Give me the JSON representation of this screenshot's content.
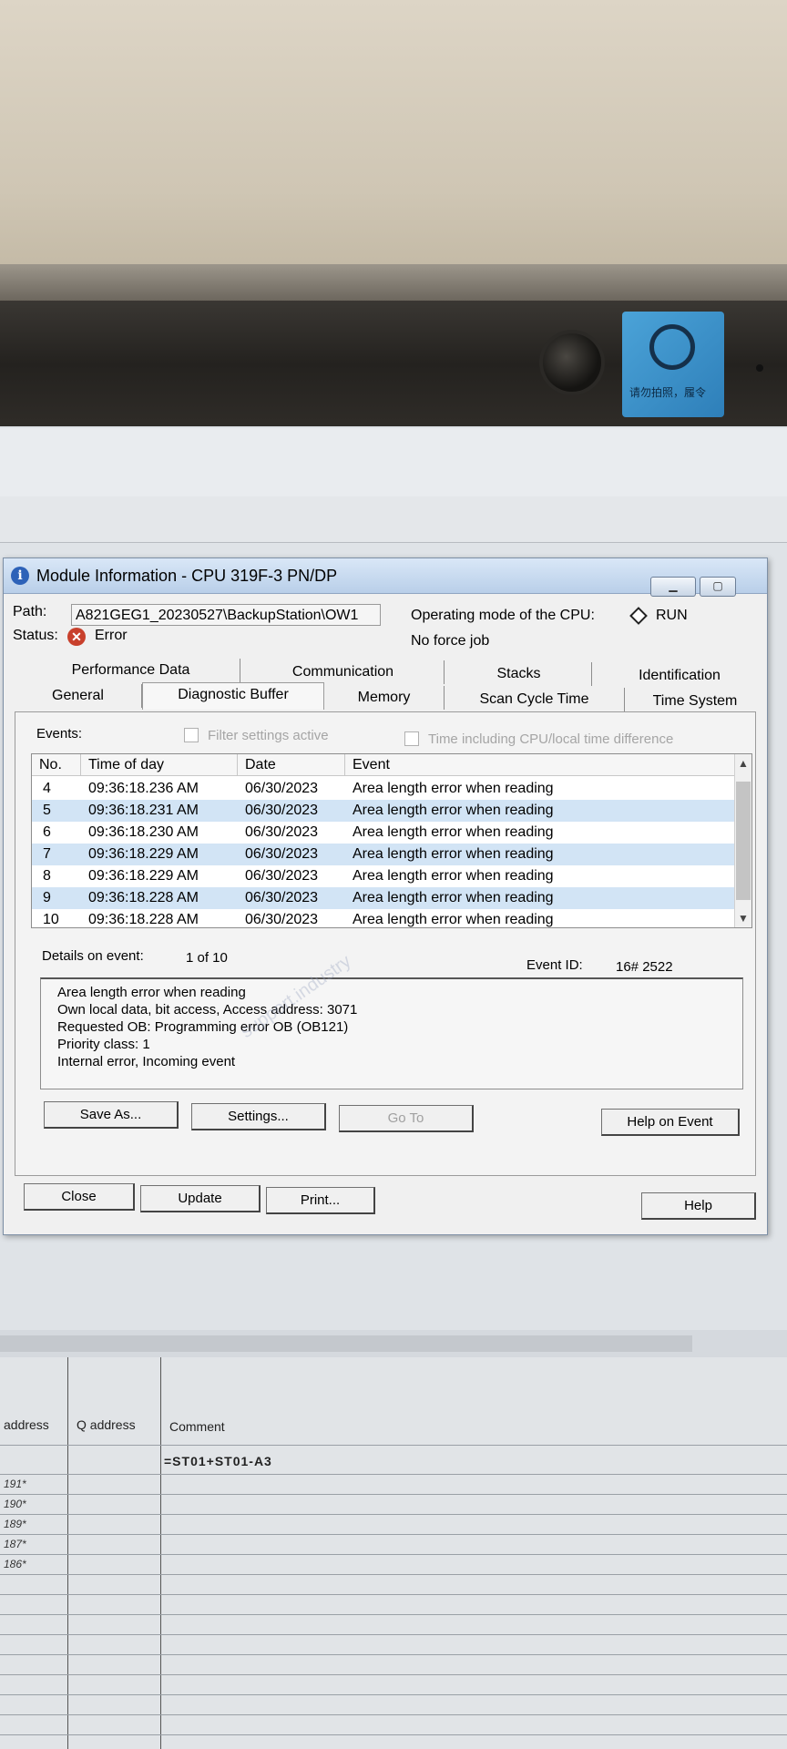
{
  "window": {
    "title": "Module Information - CPU 319F-3 PN/DP"
  },
  "info": {
    "path_label": "Path:",
    "path_value": "A821GEG1_20230527\\BackupStation\\OW1",
    "status_label": "Status:",
    "status_value": "Error",
    "opmode_label": "Operating mode of the  CPU:",
    "opmode_value": "RUN",
    "force_job": "No force job"
  },
  "tabs_row1": [
    "Performance Data",
    "Communication",
    "Stacks",
    "Identification"
  ],
  "tabs_row2": [
    "General",
    "Diagnostic Buffer",
    "Memory",
    "Scan Cycle Time",
    "Time System"
  ],
  "active_tab": "Diagnostic Buffer",
  "events": {
    "label": "Events:",
    "filter_label": "Filter settings active",
    "time_label": "Time including CPU/local time difference",
    "columns": [
      "No.",
      "Time of day",
      "Date",
      "Event"
    ],
    "rows": [
      {
        "no": "4",
        "time": "09:36:18.236 AM",
        "date": "06/30/2023",
        "event": "Area length error when reading"
      },
      {
        "no": "5",
        "time": "09:36:18.231 AM",
        "date": "06/30/2023",
        "event": "Area length error when reading"
      },
      {
        "no": "6",
        "time": "09:36:18.230 AM",
        "date": "06/30/2023",
        "event": "Area length error when reading"
      },
      {
        "no": "7",
        "time": "09:36:18.229 AM",
        "date": "06/30/2023",
        "event": "Area length error when reading"
      },
      {
        "no": "8",
        "time": "09:36:18.229 AM",
        "date": "06/30/2023",
        "event": "Area length error when reading"
      },
      {
        "no": "9",
        "time": "09:36:18.228 AM",
        "date": "06/30/2023",
        "event": "Area length error when reading"
      },
      {
        "no": "10",
        "time": "09:36:18.228 AM",
        "date": "06/30/2023",
        "event": "Area length error when reading"
      }
    ]
  },
  "details": {
    "label": "Details on event:",
    "counter": "1 of 10",
    "event_id_label": "Event ID:",
    "event_id_value": "16# 2522",
    "lines": [
      "Area length error when reading",
      "Own local data, bit access, Access address:    3071",
      "Requested OB: Programming error OB (OB121)",
      "Priority class:   1",
      "Internal error, Incoming event"
    ]
  },
  "buttons": {
    "save_as": "Save As...",
    "settings": "Settings...",
    "go_to": "Go To",
    "help_on_event": "Help on Event",
    "close": "Close",
    "update": "Update",
    "print": "Print...",
    "help": "Help"
  },
  "background_table": {
    "headers": [
      "address",
      "Q address",
      "Comment"
    ],
    "comment_row": "=ST01+ST01-A3",
    "address_cells": [
      "191*",
      "190*",
      "189*",
      "187*",
      "186*"
    ]
  },
  "sticker_text": "请勿拍照，履令"
}
